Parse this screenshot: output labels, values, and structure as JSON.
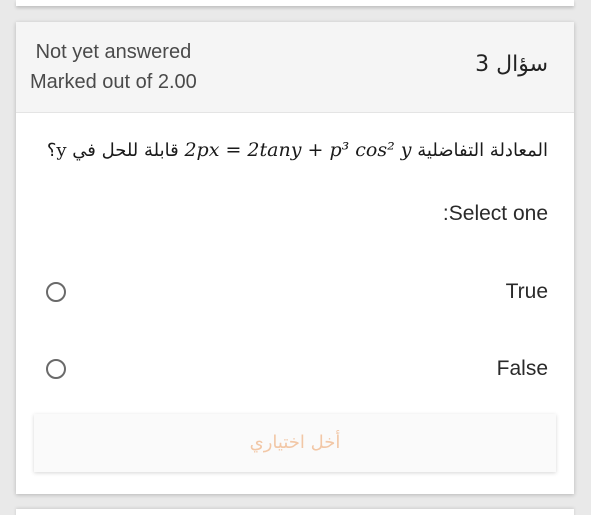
{
  "question": {
    "status_line1": "Not yet answered",
    "status_line2": "Marked out of 2.00",
    "number_label": "سؤال 3",
    "text_before": "المعادلة التفاضلية",
    "equation": "2px = 2tany + p³ cos² y",
    "text_after": "قابلة للحل في y؟",
    "select_label": ":Select one",
    "options": [
      {
        "label": "True",
        "selected": false
      },
      {
        "label": "False",
        "selected": false
      }
    ],
    "clear_label": "أخل اختياري"
  },
  "colors": {
    "header_bg": "#f5f5f5",
    "clear_text": "#f2c7a6",
    "radio_border": "#6a6a6a"
  }
}
